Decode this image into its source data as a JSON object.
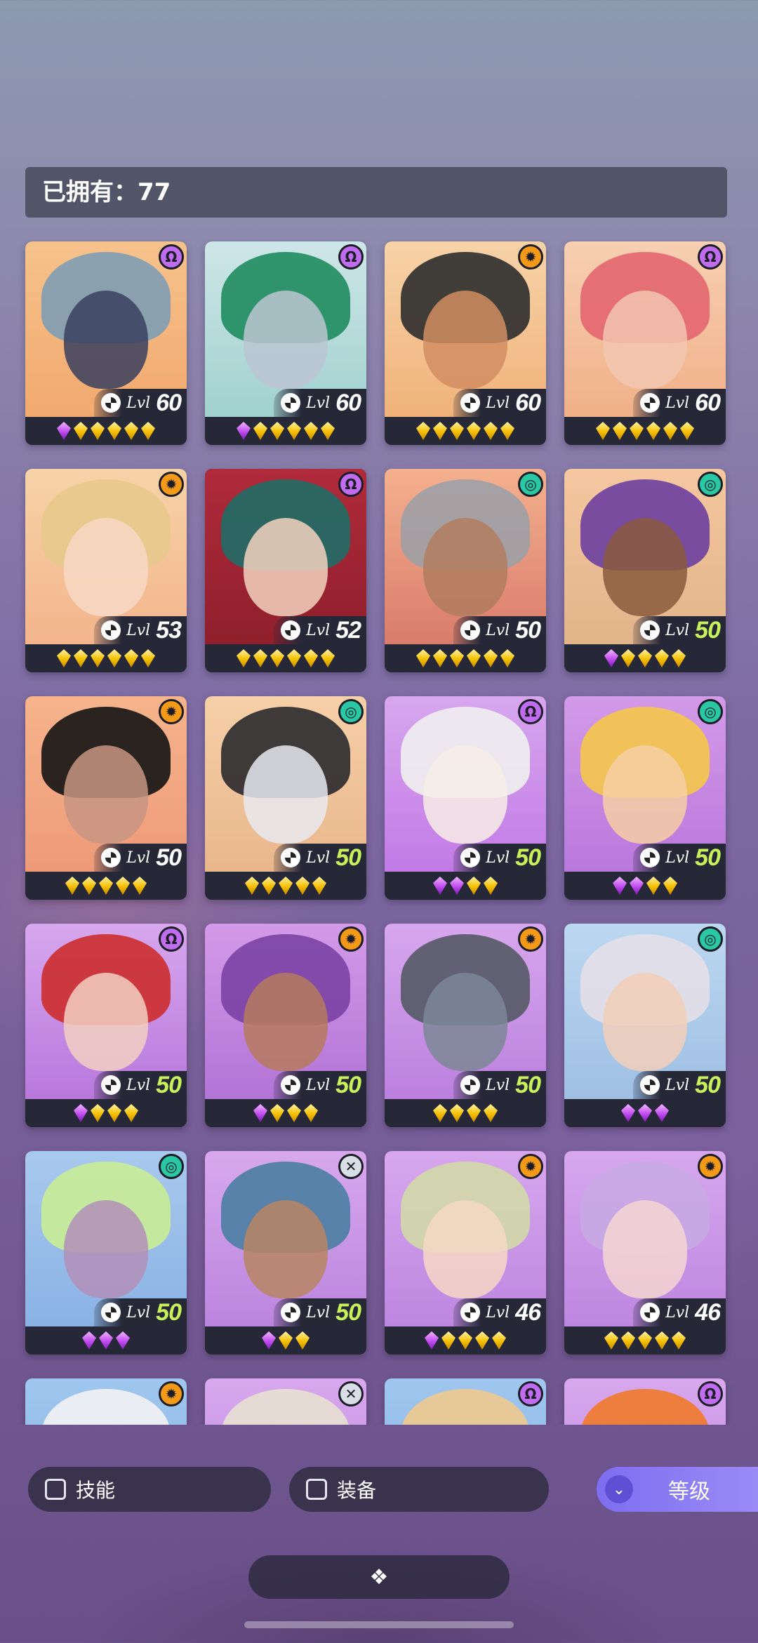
{
  "owned": {
    "label": "已拥有：77"
  },
  "cards": [
    {
      "level": "60",
      "green": false,
      "badge": "purple",
      "badge_icon": "mind-icon",
      "top": "#f6c28c",
      "bottom": "#f1a96e",
      "hair": "#7f9db4",
      "face": "#38405e",
      "stars": [
        "purple",
        "gold",
        "gold",
        "gold",
        "gold",
        "gold"
      ]
    },
    {
      "level": "60",
      "green": false,
      "badge": "purple",
      "badge_icon": "mind-icon",
      "top": "#cfe6e8",
      "bottom": "#a0d1cf",
      "hair": "#1f8c5e",
      "face": "#bcc5d2",
      "stars": [
        "purple",
        "gold",
        "gold",
        "gold",
        "gold",
        "gold"
      ]
    },
    {
      "level": "60",
      "green": false,
      "badge": "orange",
      "badge_icon": "sun-icon",
      "top": "#f7d3a8",
      "bottom": "#f0b27a",
      "hair": "#2d2d2d",
      "face": "#d18d62",
      "stars": [
        "gold",
        "gold",
        "gold",
        "gold",
        "gold",
        "gold"
      ]
    },
    {
      "level": "60",
      "green": false,
      "badge": "purple",
      "badge_icon": "mind-icon",
      "top": "#f7cfb2",
      "bottom": "#f0b088",
      "hair": "#e3666f",
      "face": "#f2c7b0",
      "stars": [
        "gold",
        "gold",
        "gold",
        "gold",
        "gold",
        "gold"
      ]
    },
    {
      "level": "53",
      "green": false,
      "badge": "orange",
      "badge_icon": "sun-icon",
      "top": "#f7d3a8",
      "bottom": "#f3b48c",
      "hair": "#e8c98c",
      "face": "#f7d8c4",
      "stars": [
        "gold",
        "gold",
        "gold",
        "gold",
        "gold",
        "gold"
      ]
    },
    {
      "level": "52",
      "green": false,
      "badge": "purple",
      "badge_icon": "mind-icon",
      "top": "#b02b3b",
      "bottom": "#8f1f2c",
      "hair": "#1f6d66",
      "face": "#f3d2c0",
      "stars": [
        "gold",
        "gold",
        "gold",
        "gold",
        "gold",
        "gold"
      ]
    },
    {
      "level": "50",
      "green": false,
      "badge": "teal",
      "badge_icon": "swirl-icon",
      "top": "#f4b08e",
      "bottom": "#d97c6b",
      "hair": "#9da0a6",
      "face": "#b07d5f",
      "stars": [
        "gold",
        "gold",
        "gold",
        "gold",
        "gold",
        "gold"
      ]
    },
    {
      "level": "50",
      "green": true,
      "badge": "teal",
      "badge_icon": "swirl-icon",
      "top": "#f6c7a0",
      "bottom": "#e2b48a",
      "hair": "#6b3fa0",
      "face": "#8a5a3c",
      "stars": [
        "purple",
        "gold",
        "gold",
        "gold",
        "gold"
      ]
    },
    {
      "level": "50",
      "green": false,
      "badge": "orange",
      "badge_icon": "sun-icon",
      "top": "#f6b48c",
      "bottom": "#ee9a78",
      "hair": "#141414",
      "face": "#c79583",
      "stars": [
        "gold",
        "gold",
        "gold",
        "gold",
        "gold"
      ]
    },
    {
      "level": "50",
      "green": true,
      "badge": "teal",
      "badge_icon": "swirl-icon",
      "top": "#f6d0a8",
      "bottom": "#e9b68c",
      "hair": "#2a2a2e",
      "face": "#e8eaf0",
      "stars": [
        "gold",
        "gold",
        "gold",
        "gold",
        "gold"
      ]
    },
    {
      "level": "50",
      "green": true,
      "badge": "purple",
      "badge_icon": "mind-icon",
      "top": "#d7a7ee",
      "bottom": "#c27ae6",
      "hair": "#f0f0f0",
      "face": "#f7ede6",
      "stars": [
        "purple",
        "purple",
        "gold",
        "gold"
      ]
    },
    {
      "level": "50",
      "green": true,
      "badge": "teal",
      "badge_icon": "swirl-icon",
      "top": "#d39ae8",
      "bottom": "#b978dc",
      "hair": "#f5c84a",
      "face": "#f6cfa4",
      "stars": [
        "purple",
        "purple",
        "gold",
        "gold"
      ]
    },
    {
      "level": "50",
      "green": true,
      "badge": "purple",
      "badge_icon": "mind-icon",
      "top": "#d7a7ee",
      "bottom": "#b878dc",
      "hair": "#cc2d2d",
      "face": "#f2d0c2",
      "stars": [
        "purple",
        "gold",
        "gold",
        "gold"
      ]
    },
    {
      "level": "50",
      "green": true,
      "badge": "orange",
      "badge_icon": "sun-icon",
      "top": "#d39ae8",
      "bottom": "#b274d6",
      "hair": "#7b42a4",
      "face": "#b67a5e",
      "stars": [
        "purple",
        "gold",
        "gold",
        "gold"
      ]
    },
    {
      "level": "50",
      "green": true,
      "badge": "orange",
      "badge_icon": "sun-icon",
      "top": "#d7a7ee",
      "bottom": "#bb80de",
      "hair": "#555a66",
      "face": "#7d8796",
      "stars": [
        "gold",
        "gold",
        "gold",
        "gold"
      ]
    },
    {
      "level": "50",
      "green": true,
      "badge": "teal",
      "badge_icon": "swirl-icon",
      "top": "#bcd7f0",
      "bottom": "#9fc0e4",
      "hair": "#e4dfe8",
      "face": "#f2cfb9",
      "stars": [
        "purple",
        "purple",
        "purple"
      ]
    },
    {
      "level": "50",
      "green": true,
      "badge": "teal",
      "badge_icon": "swirl-icon",
      "top": "#a9c9ee",
      "bottom": "#8ab2e4",
      "hair": "#c8ec96",
      "face": "#b18fb8",
      "stars": [
        "purple",
        "purple",
        "purple"
      ]
    },
    {
      "level": "50",
      "green": true,
      "badge": "gray",
      "badge_icon": "cross-icon",
      "top": "#d8a8ee",
      "bottom": "#bb84de",
      "hair": "#4a7ea2",
      "face": "#b98562",
      "stars": [
        "purple",
        "gold",
        "gold"
      ]
    },
    {
      "level": "46",
      "green": false,
      "badge": "orange",
      "badge_icon": "sun-icon",
      "top": "#d7a7ee",
      "bottom": "#bd86e0",
      "hair": "#d2d9a8",
      "face": "#f6d7c6",
      "stars": [
        "purple",
        "gold",
        "gold",
        "gold",
        "gold"
      ]
    },
    {
      "level": "46",
      "green": false,
      "badge": "orange",
      "badge_icon": "sun-icon",
      "top": "#d7a7ee",
      "bottom": "#bd86e0",
      "hair": "#c8a8e4",
      "face": "#f5d6d2",
      "stars": [
        "gold",
        "gold",
        "gold",
        "gold",
        "gold"
      ]
    },
    {
      "level": "",
      "green": false,
      "badge": "orange",
      "badge_icon": "sun-icon",
      "top": "#9fc6ee",
      "bottom": "#8ab2e4",
      "hair": "#f3f3f3",
      "face": "#e8cfc0",
      "stars": []
    },
    {
      "level": "",
      "green": false,
      "badge": "gray",
      "badge_icon": "cross-icon",
      "top": "#d8a8ee",
      "bottom": "#bb84de",
      "hair": "#e8e1d2",
      "face": "#f0d8cc",
      "stars": []
    },
    {
      "level": "",
      "green": false,
      "badge": "purple",
      "badge_icon": "mind-icon",
      "top": "#9fc6ee",
      "bottom": "#8ab2e4",
      "hair": "#f0c98e",
      "face": "#e8cfc0",
      "stars": []
    },
    {
      "level": "",
      "green": false,
      "badge": "purple",
      "badge_icon": "mind-icon",
      "top": "#d8a8ee",
      "bottom": "#bb84de",
      "hair": "#f07a2a",
      "face": "#f2d0c2",
      "stars": []
    }
  ],
  "level_prefix": "Lvl",
  "filters": {
    "skill": "技能",
    "equip": "装备"
  },
  "sort": {
    "label": "等级"
  },
  "dock": {
    "icon": "❖"
  }
}
